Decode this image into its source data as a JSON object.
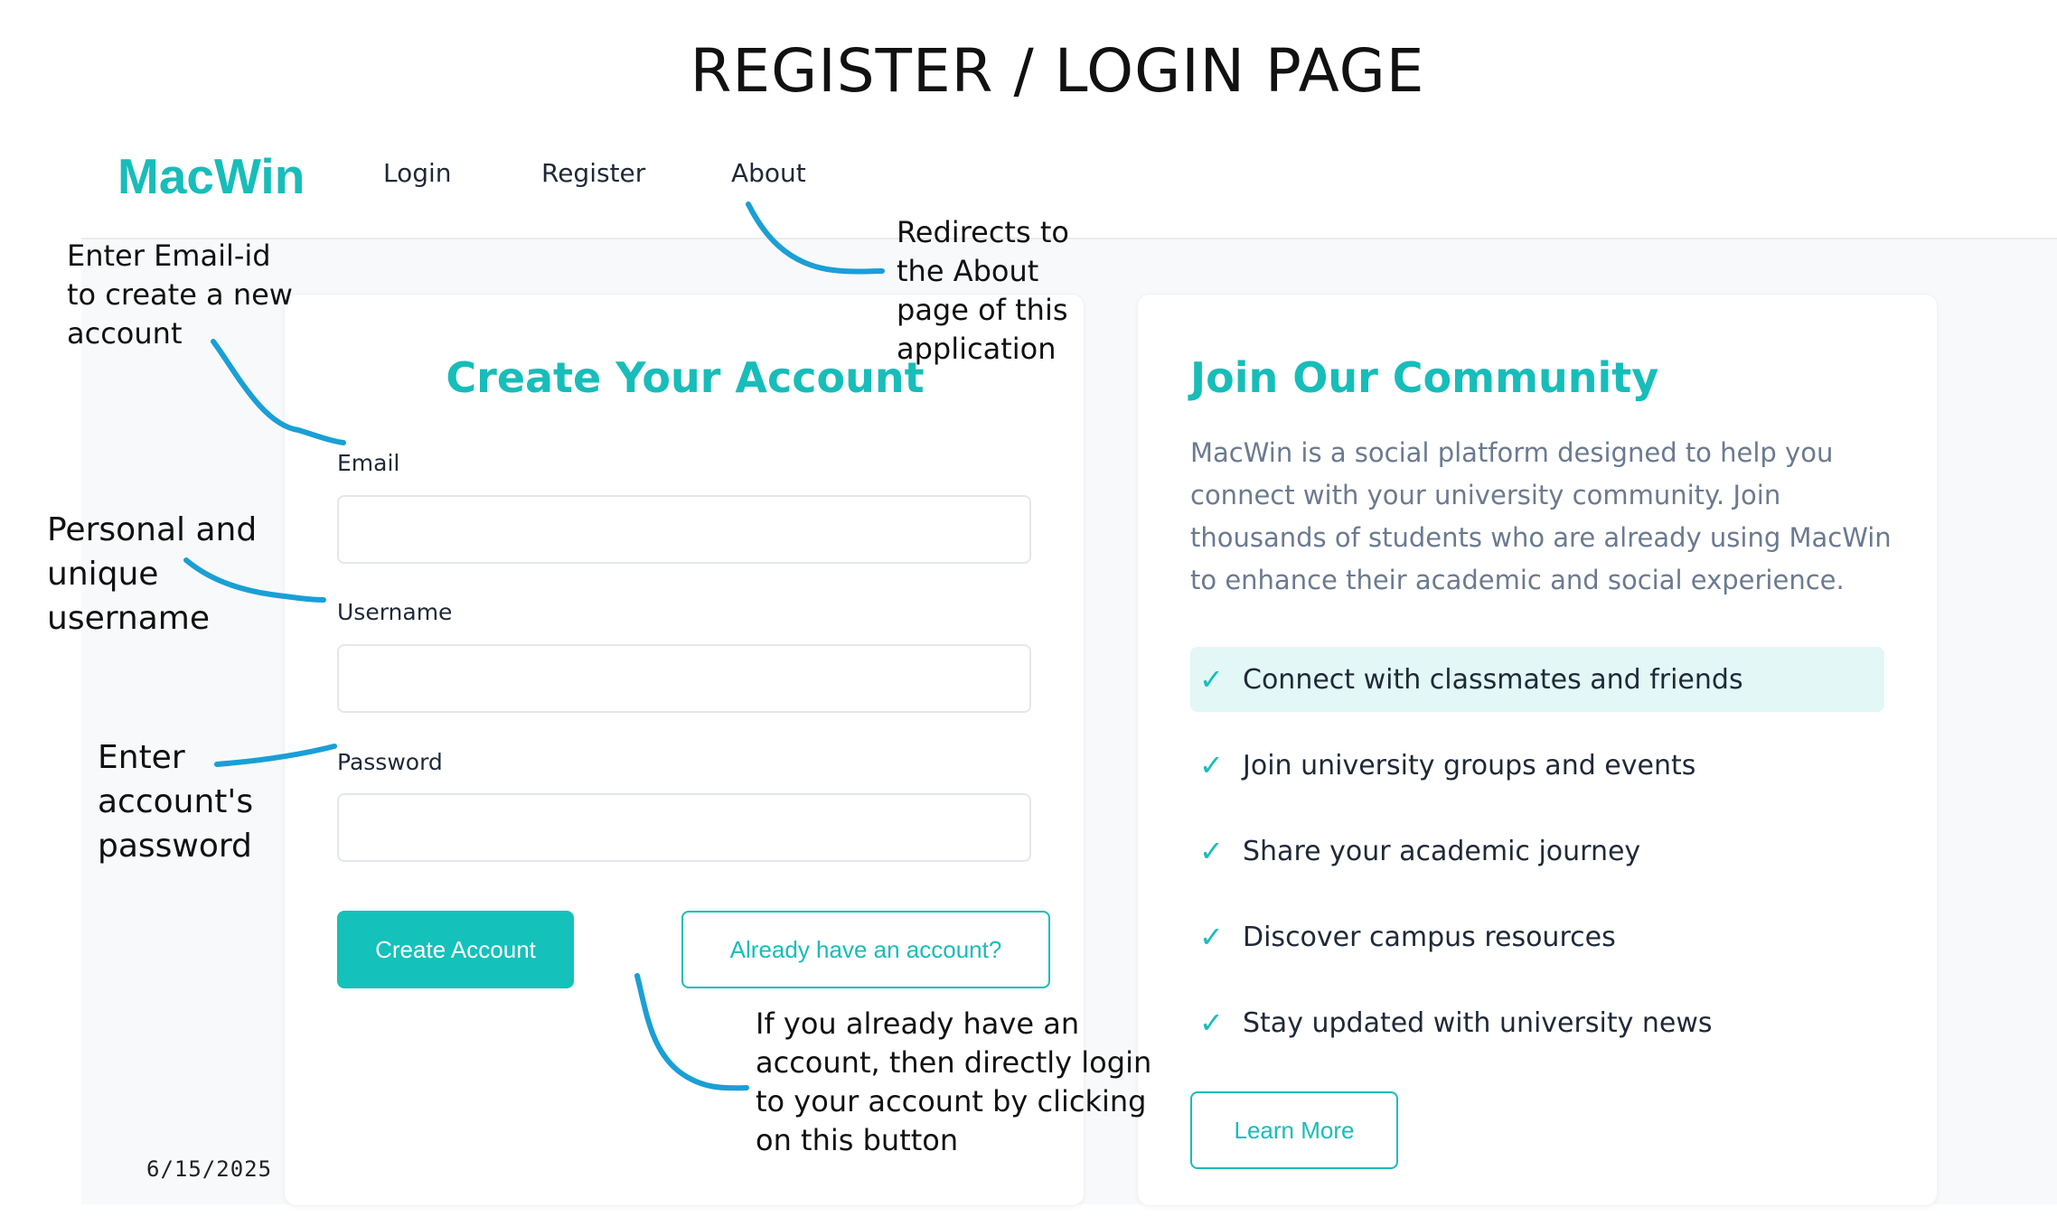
{
  "slide_title": "REGISTER / LOGIN  PAGE",
  "app": {
    "brand": "MacWin",
    "nav": [
      "Login",
      "Register",
      "About"
    ],
    "register": {
      "title": "Create Your Account",
      "email_label": "Email",
      "username_label": "Username",
      "password_label": "Password",
      "email_value": "",
      "username_value": "",
      "password_value": "",
      "create_button": "Create Account",
      "login_button": "Already have an account?"
    },
    "community": {
      "title": "Join Our Community",
      "description": "MacWin is a social platform designed to help you connect with your university community. Join thousands of students who are already using MacWin to enhance their academic and social experience.",
      "features": [
        "Connect with classmates and friends",
        "Join university groups and events",
        "Share your academic journey",
        "Discover campus resources",
        "Stay updated with university news"
      ],
      "check_icon": "✓",
      "learn_more": "Learn More"
    },
    "colors": {
      "accent": "#17bdb9",
      "highlight": "#e2f7f6",
      "annotation_line": "#1a9fd6"
    }
  },
  "annotations": {
    "email": "Enter Email-id to create a new account",
    "username": "Personal and unique username",
    "password": "Enter account's password",
    "about": "Redirects to the About page of this application",
    "login": "If you already have an account, then directly login to your account by clicking on this button",
    "date": "6/15/2025"
  }
}
